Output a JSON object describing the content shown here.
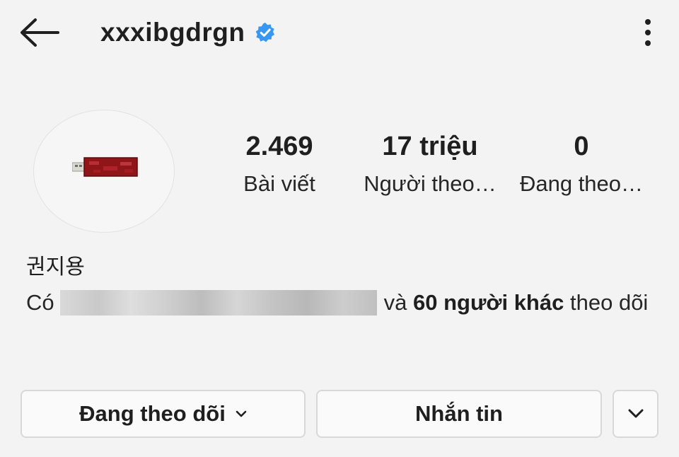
{
  "header": {
    "username": "xxxibgdrgn",
    "verified": true,
    "accent_color": "#3897f0"
  },
  "profile": {
    "avatar": "usb-drive-image"
  },
  "stats": {
    "posts": {
      "value": "2.469",
      "label": "Bài viết"
    },
    "followers": {
      "value": "17 triệu",
      "label": "Người theo…"
    },
    "following": {
      "value": "0",
      "label": "Đang theo…"
    }
  },
  "bio": {
    "name": "권지용"
  },
  "followed_by": {
    "prefix": "Có",
    "connector": "và",
    "others": "60 người khác",
    "suffix_1": "theo",
    "suffix_2": "dõi"
  },
  "actions": {
    "following_label": "Đang theo dõi",
    "message_label": "Nhắn tin"
  },
  "icons": {
    "back": "back-arrow-icon",
    "verified": "verified-badge-icon",
    "more": "more-vertical-icon",
    "following_dropdown": "chevron-down-icon",
    "suggested": "chevron-down-icon"
  }
}
